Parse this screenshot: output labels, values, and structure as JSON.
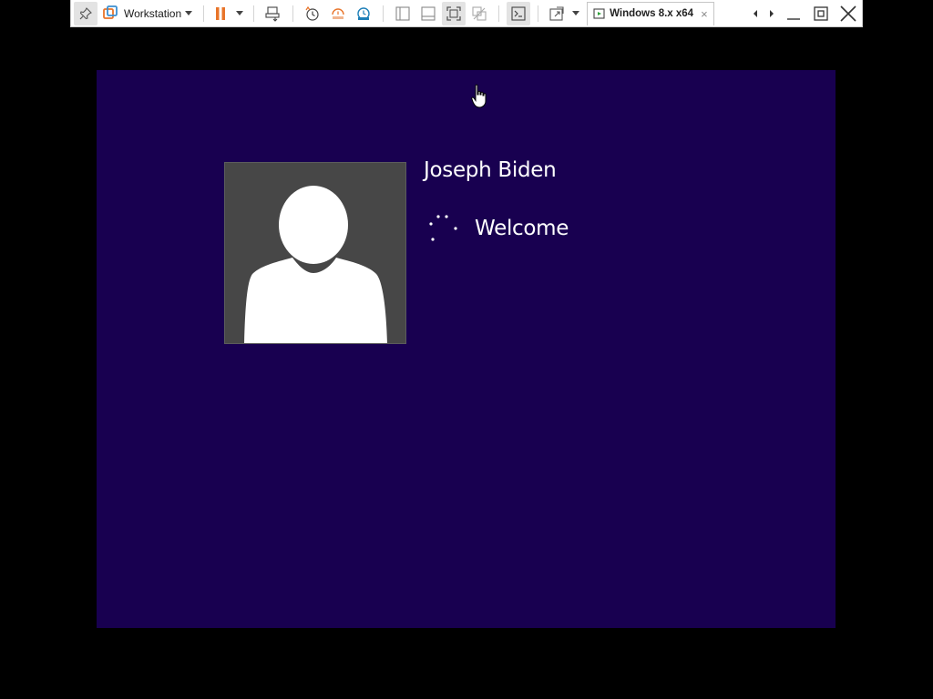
{
  "toolbar": {
    "library_label": "Workstation",
    "vm_tab_label": "Windows 8.x x64",
    "tab_close": "×",
    "icons": [
      "pin-icon",
      "workstation-logo-icon",
      "pause-icon",
      "send-ctrl-alt-del-icon",
      "snapshot-take-icon",
      "snapshot-revert-icon",
      "snapshot-manager-icon",
      "view-sidebar-icon",
      "view-thumbnail-icon",
      "full-screen-icon",
      "unity-icon",
      "console-view-icon",
      "stretch-guest-icon",
      "tab-prev-icon",
      "tab-next-icon",
      "minimize-icon",
      "restore-icon",
      "close-window-icon"
    ],
    "accent_color": "#e8742a"
  },
  "guest": {
    "background_color": "#180050",
    "user_name": "Joseph Biden",
    "status_text": "Welcome",
    "avatar_icon": "default-user-avatar-icon"
  }
}
